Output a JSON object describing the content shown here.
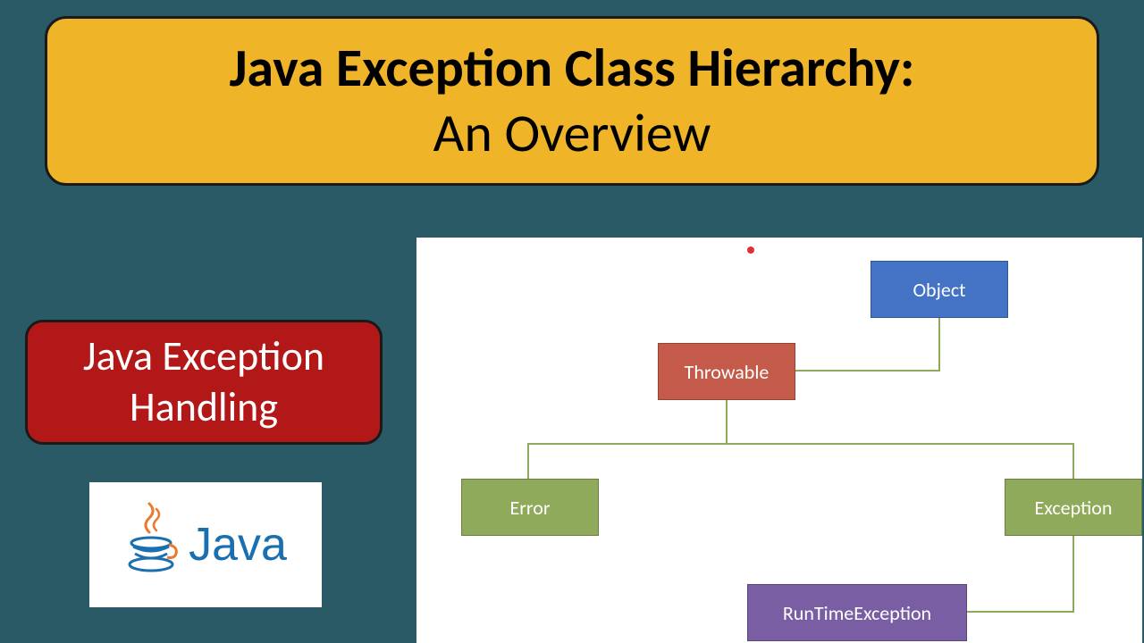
{
  "title": {
    "line1": "Java Exception Class Hierarchy:",
    "line2": "An Overview"
  },
  "subtitle": {
    "line1": "Java Exception",
    "line2": "Handling"
  },
  "javaLogo": {
    "text": "Java"
  },
  "diagram": {
    "nodes": {
      "object": "Object",
      "throwable": "Throwable",
      "error": "Error",
      "exception": "Exception",
      "runtime": "RunTimeException"
    }
  }
}
